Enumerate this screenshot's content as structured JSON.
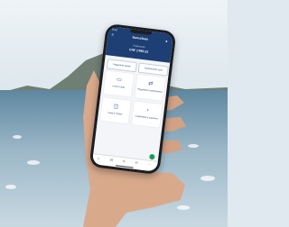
{
  "colors": {
    "brand_primary": "#1d3f73",
    "accent": "#2d5aa0",
    "fab": "#1f9a5a",
    "sea": "#5f87a0"
  },
  "status_bar": {
    "time": "9:41"
  },
  "header": {
    "title": "BancaStato",
    "menu_icon": "menu-icon",
    "profile_icon": "profile-icon",
    "balance_label": "Patrimonio",
    "balance_value": "CHF 1'485.23"
  },
  "quick_actions": [
    {
      "label": "Pagamento rapido",
      "icon": "bolt-icon"
    },
    {
      "label": "Trasferimento conti",
      "icon": "transfer-icon"
    }
  ],
  "tiles": [
    {
      "label": "Conti e carte",
      "icon": "card-icon"
    },
    {
      "label": "Pagamenti e trasferimenti",
      "icon": "arrows-icon"
    },
    {
      "label": "Carte e TWINT",
      "icon": "wallet-icon"
    },
    {
      "label": "Investimenti e risparmio",
      "icon": "chart-icon"
    }
  ],
  "tabbar": [
    {
      "label": "Home",
      "icon": "home-icon"
    },
    {
      "label": "Conti",
      "icon": "account-icon"
    },
    {
      "label": "Pagamenti",
      "icon": "payment-icon"
    },
    {
      "label": "Posta",
      "icon": "mail-icon"
    },
    {
      "label": "Altro",
      "icon": "more-icon"
    }
  ]
}
